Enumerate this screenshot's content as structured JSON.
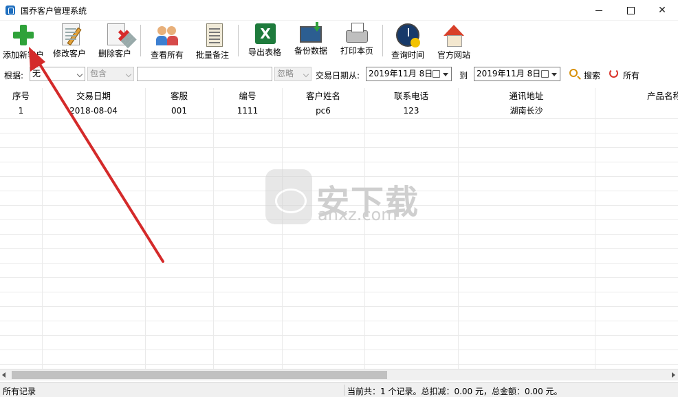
{
  "window": {
    "title": "国乔客户管理系统"
  },
  "toolbar": {
    "add": "添加新客户",
    "edit": "修改客户",
    "delete": "删除客户",
    "view_all": "查看所有",
    "batch_note": "批量备注",
    "export": "导出表格",
    "backup": "备份数据",
    "print": "打印本页",
    "query_time": "查询时间",
    "website": "官方网站"
  },
  "filter": {
    "by_label": "根据:",
    "field_value": "无",
    "op_value": "包含",
    "keyword_value": "",
    "ignore_value": "忽略",
    "date_from_label": "交易日期从:",
    "date_from": "2019年11月 8日",
    "to_label": "到",
    "date_to": "2019年11月 8日",
    "search": "搜索",
    "all": "所有"
  },
  "table": {
    "columns": [
      "序号",
      "交易日期",
      "客服",
      "编号",
      "客户姓名",
      "联系电话",
      "通讯地址",
      "产品名称"
    ],
    "rows": [
      [
        "1",
        "2018-08-04",
        "001",
        "1111",
        "pc6",
        "123",
        "湖南长沙",
        ""
      ]
    ]
  },
  "watermark": {
    "brand": "安下载",
    "url": "anxz.com"
  },
  "status": {
    "left": "所有记录",
    "right": "当前共：1 个记录。总扣减：0.00 元，总金额：0.00 元。"
  },
  "colors": {
    "arrow": "#d42a2a",
    "accent_green": "#2fa23a"
  }
}
